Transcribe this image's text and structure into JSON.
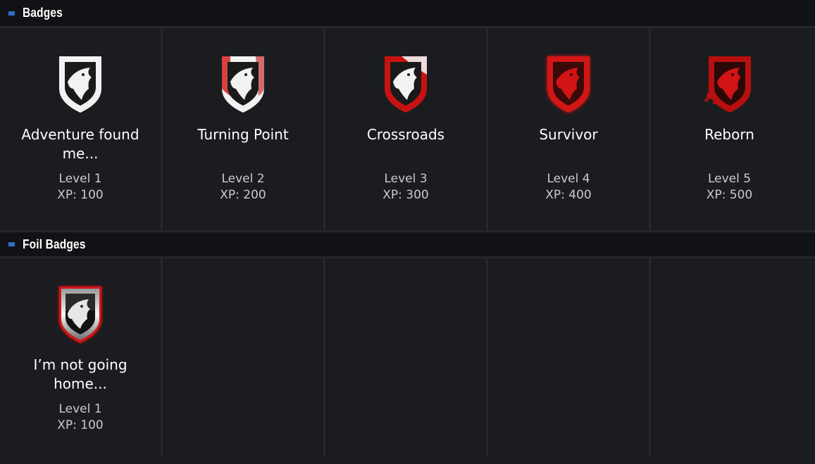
{
  "sections": [
    {
      "title": "Badges",
      "badges": [
        {
          "name": "Adventure found me...",
          "level": "Level 1",
          "xp": "XP: 100",
          "style": "white"
        },
        {
          "name": "Turning Point",
          "level": "Level 2",
          "xp": "XP: 200",
          "style": "white-red"
        },
        {
          "name": "Crossroads",
          "level": "Level 3",
          "xp": "XP: 300",
          "style": "red-white"
        },
        {
          "name": "Survivor",
          "level": "Level 4",
          "xp": "XP: 400",
          "style": "red-glow"
        },
        {
          "name": "Reborn",
          "level": "Level 5",
          "xp": "XP: 500",
          "style": "red-splatter"
        }
      ]
    },
    {
      "title": "Foil Badges",
      "badges": [
        {
          "name": "I’m not going home...",
          "level": "Level 1",
          "xp": "XP: 100",
          "style": "foil"
        }
      ]
    }
  ],
  "icons": {
    "section_marker": "square-marker-icon",
    "badge": "eagle-shield-badge-icon"
  },
  "colors": {
    "marker": "#2e6fd0",
    "badge_red": "#d21414",
    "badge_white": "#f2f2f2"
  }
}
